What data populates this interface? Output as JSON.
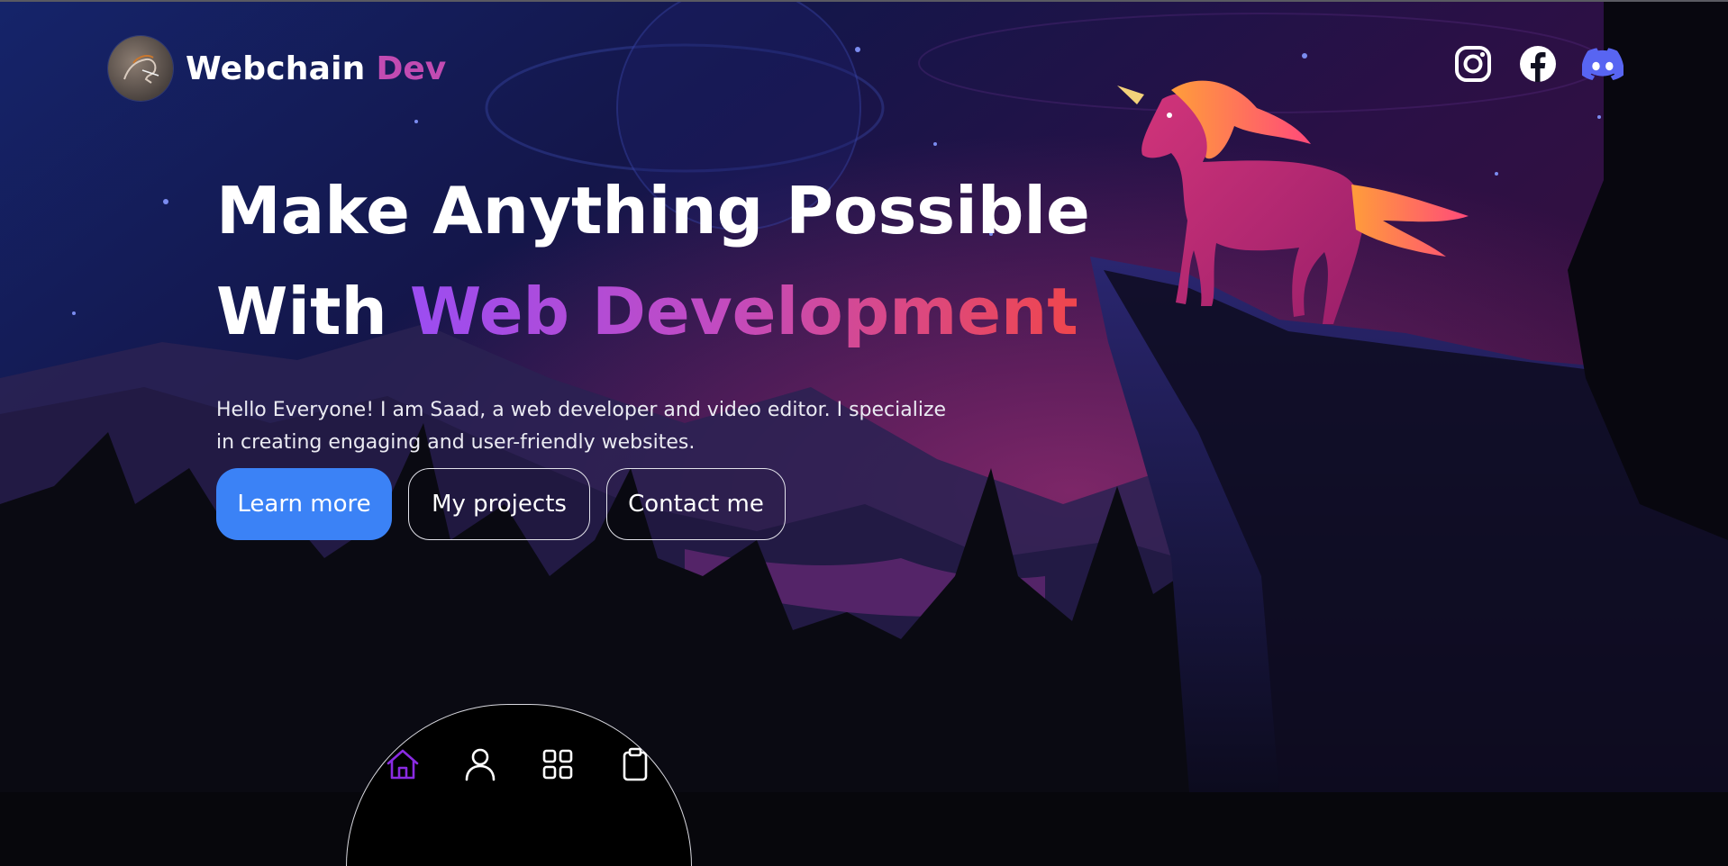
{
  "brand": {
    "name": "Webchain",
    "accent": "Dev",
    "accent_color": "#c24bb2",
    "logo_icon": "horse-logo-icon"
  },
  "social": [
    {
      "name": "instagram-icon",
      "color": "#ffffff"
    },
    {
      "name": "facebook-icon",
      "color": "#ffffff"
    },
    {
      "name": "discord-icon",
      "color": "#5865f2"
    }
  ],
  "hero": {
    "line1": "Make Anything Possible",
    "line2_prefix": "With",
    "line2_highlight": "Web Development",
    "description": "Hello Everyone! I am Saad, a web developer and video editor. I specialize in creating engaging and user-friendly websites."
  },
  "buttons": {
    "learn_more": "Learn more",
    "my_projects": "My projects",
    "contact_me": "Contact me",
    "primary_color": "#3b82f6"
  },
  "dock": {
    "items": [
      {
        "icon": "home-icon",
        "active": true,
        "color": "#8a2be2"
      },
      {
        "icon": "user-icon",
        "active": false
      },
      {
        "icon": "grid-icon",
        "active": false
      },
      {
        "icon": "clipboard-icon",
        "active": false
      }
    ]
  }
}
